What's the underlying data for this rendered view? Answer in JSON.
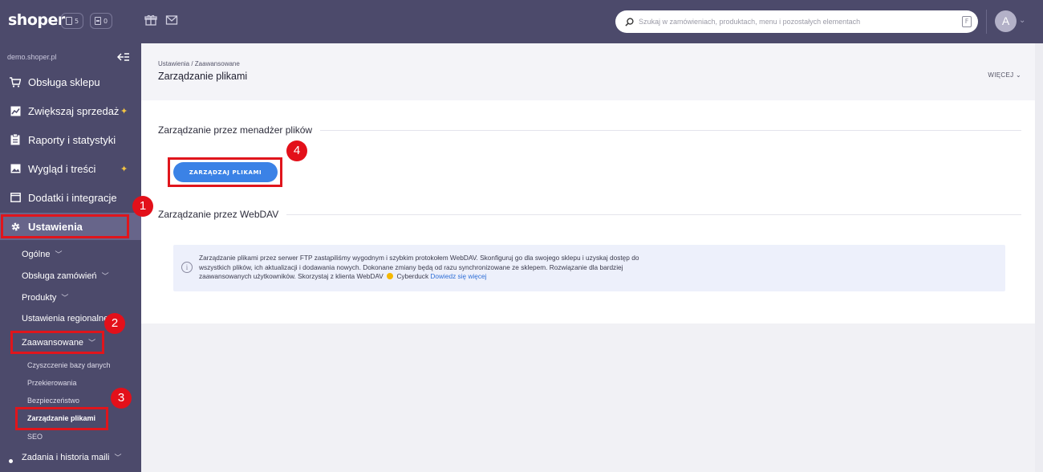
{
  "topbar": {
    "logo": "shoper",
    "orders_count": "5",
    "pending_count": "0",
    "search_placeholder": "Szukaj w zamówieniach, produktach, menu i pozostałych elementach",
    "avatar_letter": "A"
  },
  "sidebar": {
    "shop_name": "demo.shoper.pl",
    "items": [
      {
        "label": "Obsługa sklepu",
        "icon": "cart-icon"
      },
      {
        "label": "Zwiększaj sprzedaż",
        "icon": "chart-icon",
        "spark": "✦"
      },
      {
        "label": "Raporty i statystyki",
        "icon": "report-icon"
      },
      {
        "label": "Wygląd i treści",
        "icon": "image-icon",
        "spark": "✦"
      },
      {
        "label": "Dodatki i integracje",
        "icon": "window-icon"
      },
      {
        "label": "Ustawienia",
        "icon": "gear-icon"
      }
    ],
    "sub_items": [
      {
        "label": "Ogólne"
      },
      {
        "label": "Obsługa zamówień"
      },
      {
        "label": "Produkty"
      },
      {
        "label": "Ustawienia regionalne"
      },
      {
        "label": "Zaawansowane"
      }
    ],
    "advanced_items": [
      "Czyszczenie bazy danych",
      "Przekierowania",
      "Bezpieczeństwo",
      "Zarządzanie plikami",
      "SEO"
    ],
    "last_item": "Zadania i historia maili"
  },
  "header": {
    "breadcrumb": "Ustawienia  /  Zaawansowane",
    "title": "Zarządzanie plikami",
    "more_label": "WIĘCEJ"
  },
  "content": {
    "section1_title": "Zarządzanie przez menadżer plików",
    "button_label": "ZARZĄDZAJ PLIKAMI",
    "section2_title": "Zarządzanie przez WebDAV",
    "info_line1": "Zarządzanie plikami przez serwer FTP zastąpiliśmy wygodnym i szybkim protokołem WebDAV. Skonfiguruj go dla swojego sklepu i uzyskaj dostęp do",
    "info_line2": "wszystkich plików, ich aktualizacji i dodawania nowych. Dokonane zmiany będą od razu synchronizowane ze sklepem. Rozwiązanie dla bardziej",
    "info_line3_pre": "zaawansowanych użytkowników. Skorzystaj z klienta WebDAV",
    "info_line3_app": "Cyberduck",
    "info_link": "Dowiedz się więcej"
  },
  "annotations": [
    "1",
    "2",
    "3",
    "4"
  ],
  "colors": {
    "sidebar_bg": "#4c4a6b",
    "primary_button": "#3b82e6",
    "highlight": "#e0151c"
  }
}
